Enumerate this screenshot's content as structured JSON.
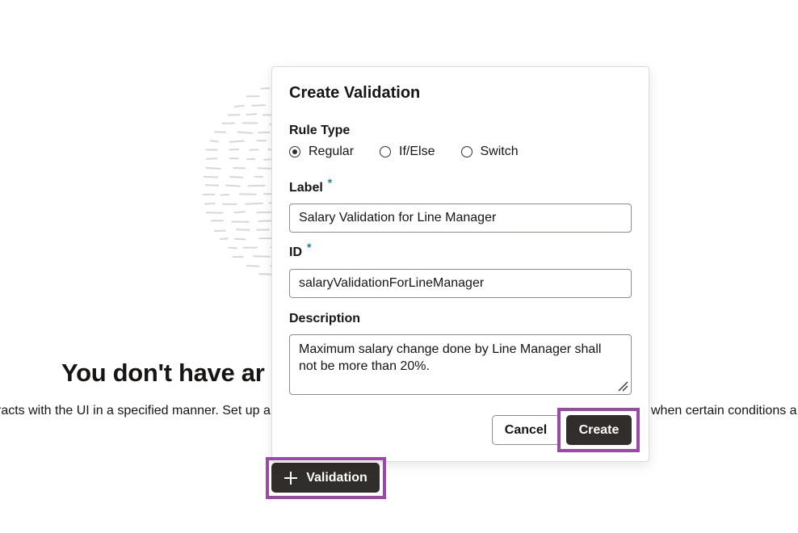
{
  "empty_state": {
    "heading": "You don't have ar",
    "description_left": "racts with the UI in a specified manner. Set up a",
    "description_right": "when certain conditions a",
    "add_button_label": "Validation",
    "add_button_icon": "plus-icon",
    "illustration": "sketch-circle-illustration"
  },
  "dialog": {
    "title": "Create Validation",
    "rule_type": {
      "label": "Rule Type",
      "options": [
        "Regular",
        "If/Else",
        "Switch"
      ],
      "selected": "Regular"
    },
    "label_field": {
      "label": "Label",
      "required_marker": "*",
      "value": "Salary Validation for Line Manager"
    },
    "id_field": {
      "label": "ID",
      "required_marker": "*",
      "value": "salaryValidationForLineManager"
    },
    "description_field": {
      "label": "Description",
      "value": "Maximum salary change done by Line Manager shall not be more than 20%."
    },
    "cancel_label": "Cancel",
    "create_label": "Create"
  },
  "colors": {
    "primary_button": "#312d2a",
    "highlight": "#9a49a6",
    "required": "#227e9e"
  }
}
